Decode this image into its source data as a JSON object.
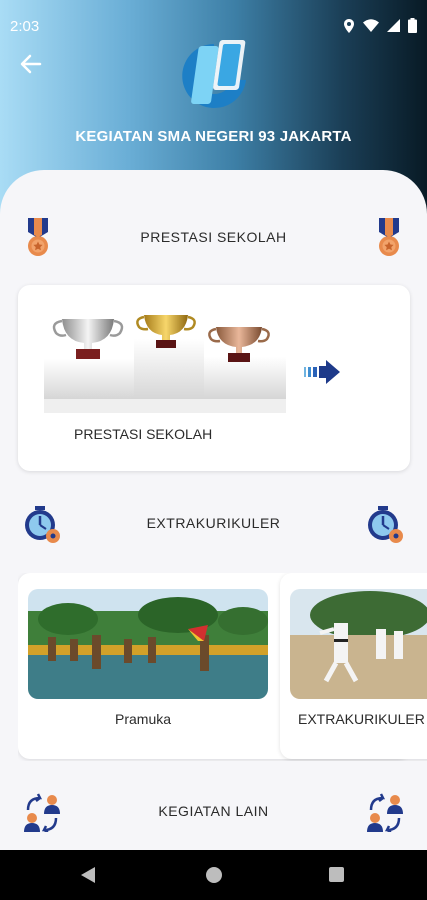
{
  "status_bar": {
    "time": "2:03",
    "icons": [
      "location-icon",
      "wifi-icon",
      "signal-icon",
      "battery-icon"
    ]
  },
  "header": {
    "title": "KEGIATAN SMA NEGERI 93 JAKARTA",
    "back_icon": "arrow-left-icon",
    "logo_icon": "school-logo-icon"
  },
  "sections": [
    {
      "label": "PRESTASI SEKOLAH",
      "icon": "medal-icon"
    },
    {
      "label": "EXTRAKURIKULER",
      "icon": "stopwatch-icon"
    },
    {
      "label": "KEGIATAN LAIN",
      "icon": "people-exchange-icon"
    }
  ],
  "prestasi_card": {
    "caption": "PRESTASI SEKOLAH",
    "image": "trophies-on-podium",
    "arrow_icon": "arrow-right-icon"
  },
  "ekskul_cards": [
    {
      "caption": "Pramuka",
      "image": "scouts-on-court"
    },
    {
      "caption": "EXTRAKURIKULER",
      "image": "karate-practice"
    }
  ],
  "colors": {
    "accent": "#1e3a8a",
    "medal": "#e88a4c",
    "ribbon": "#223a8c",
    "background": "#f6f6f9"
  },
  "nav_bar": {
    "icons": [
      "nav-back-icon",
      "nav-home-icon",
      "nav-recents-icon"
    ]
  }
}
